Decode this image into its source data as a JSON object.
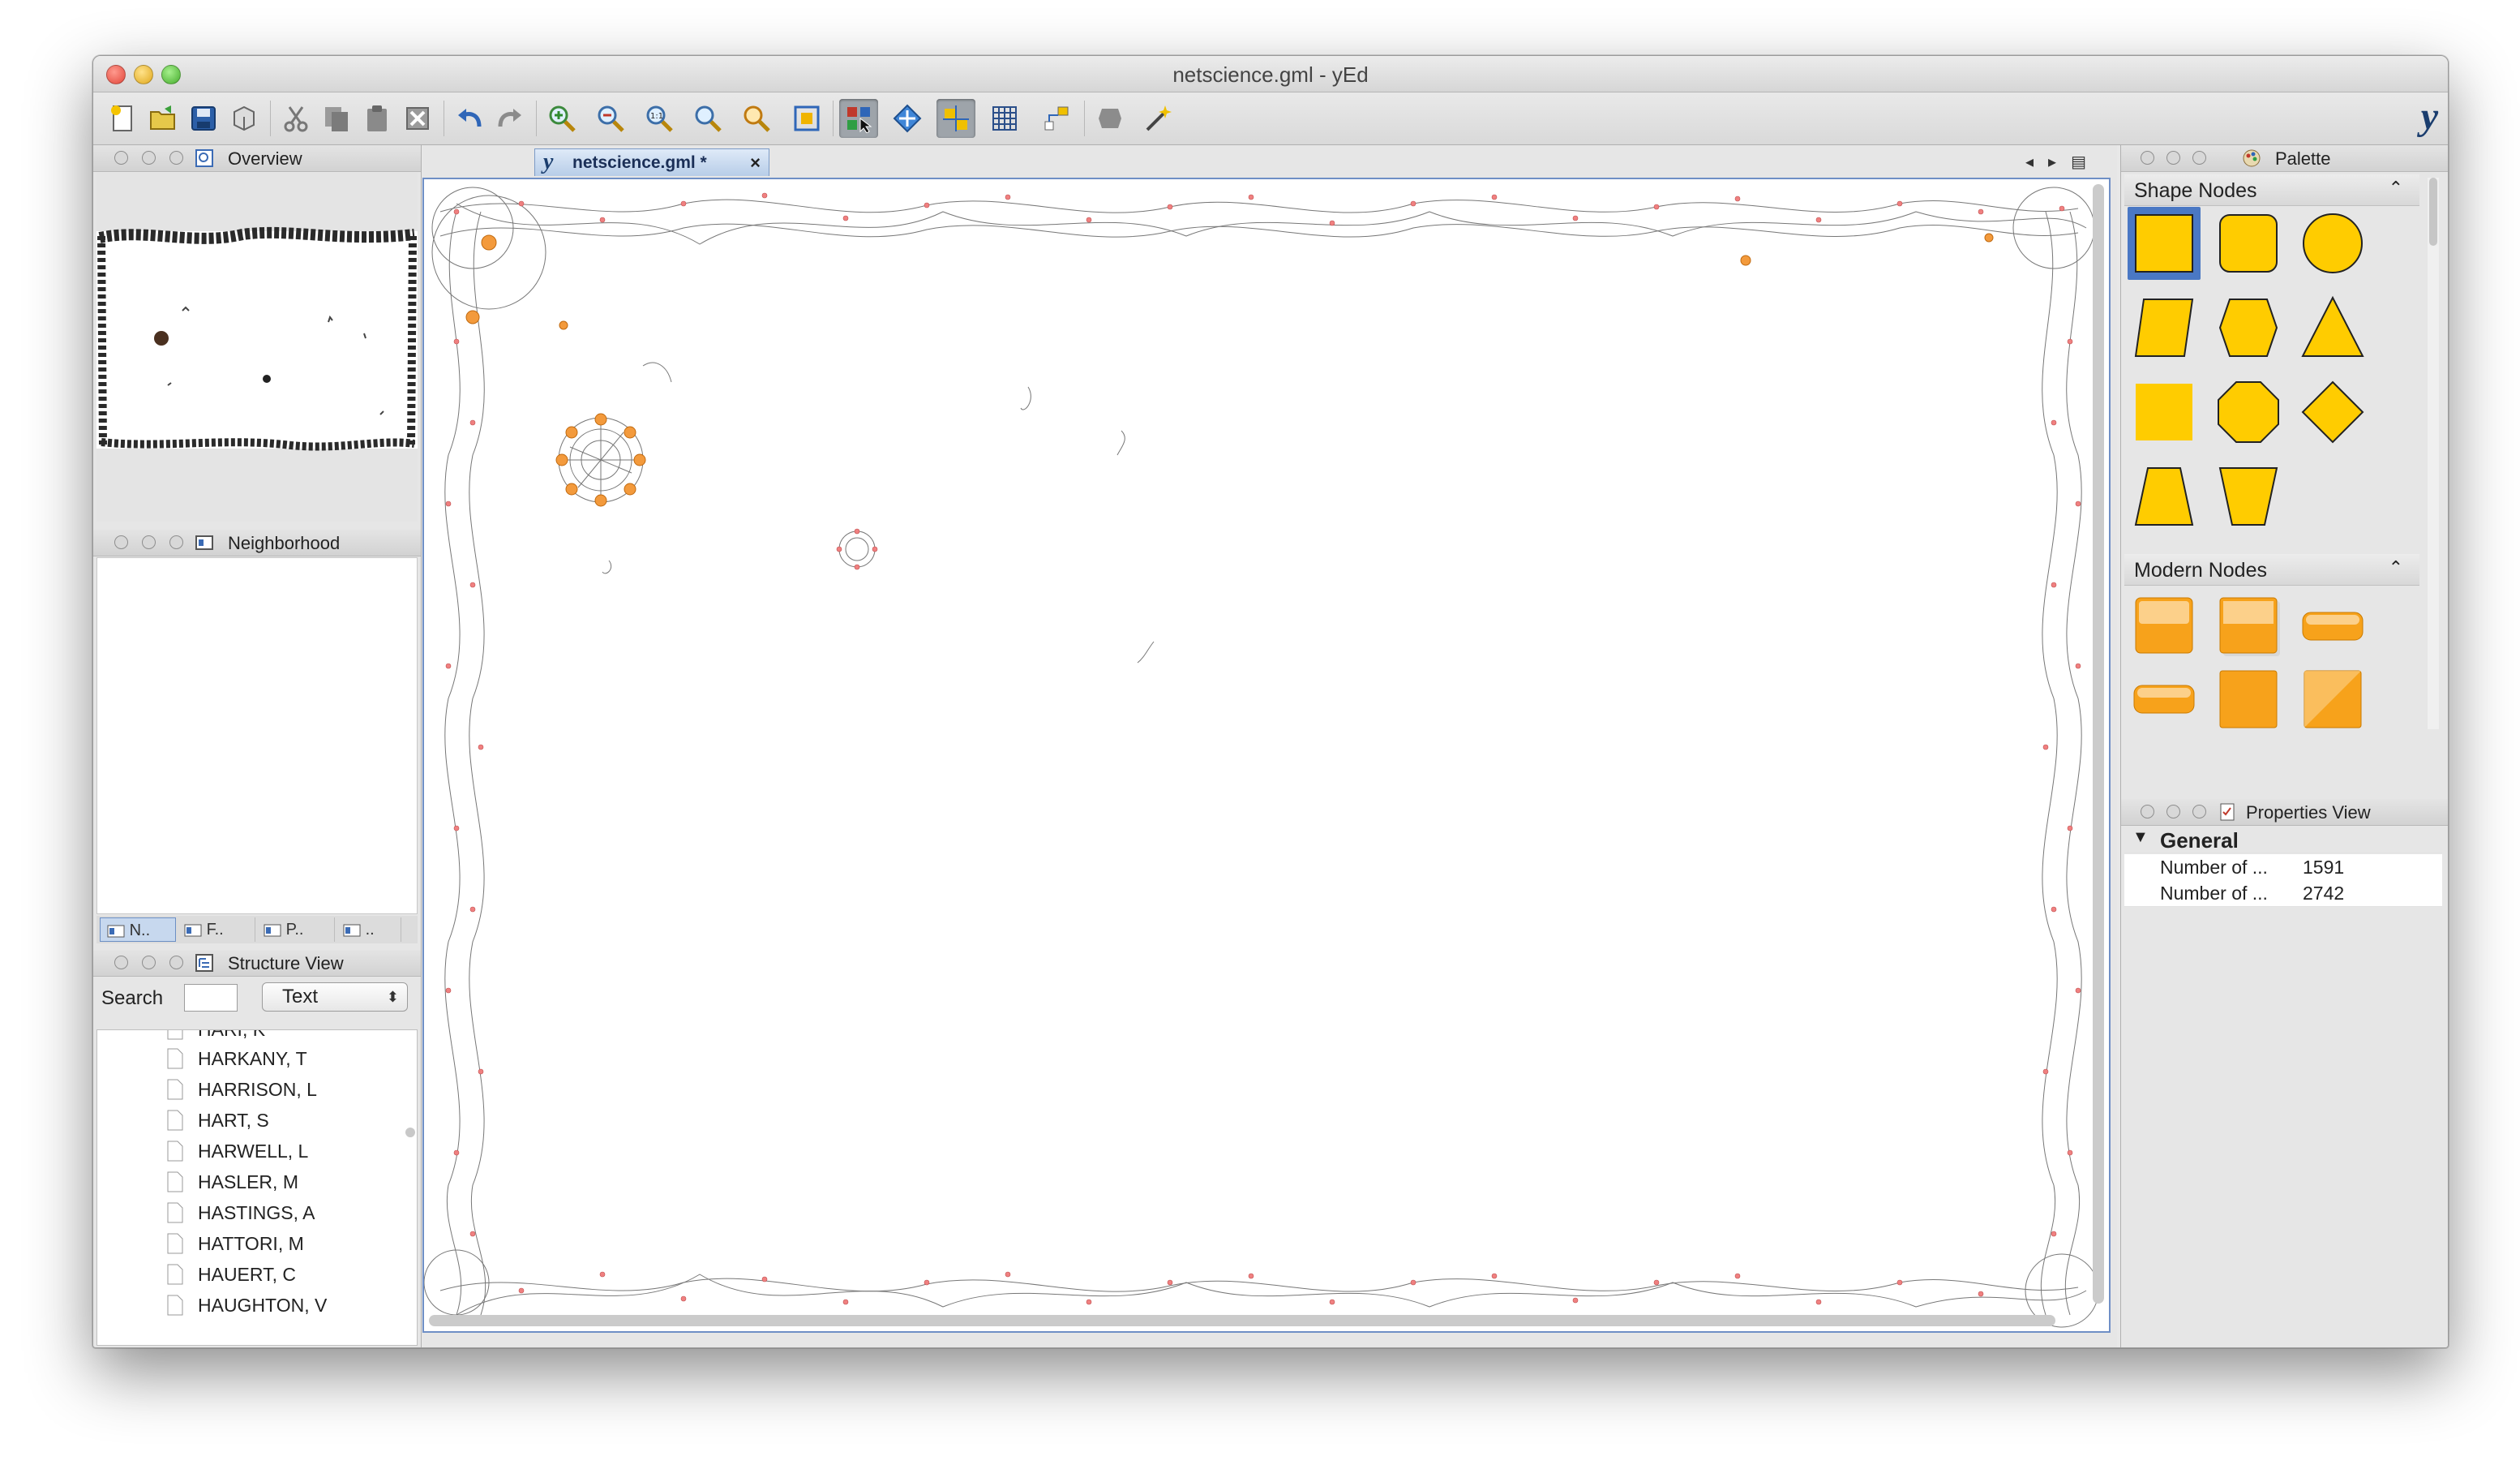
{
  "window": {
    "title": "netscience.gml - yEd"
  },
  "toolbar": {
    "buttons": [
      "new-icon",
      "open-icon",
      "save-icon",
      "export-icon",
      "cut-icon",
      "copy-icon",
      "paste-icon",
      "delete-icon",
      "undo-icon",
      "redo-icon",
      "zoom-in-icon",
      "zoom-out-icon",
      "zoom-100-icon",
      "zoom-area-icon",
      "zoom-selection-icon",
      "fit-content-icon",
      "edit-mode-icon",
      "navigate-mode-icon",
      "snap-icon",
      "grid-icon",
      "orthogonal-edges-icon",
      "layout-icon",
      "wizard-icon"
    ],
    "logo": "y"
  },
  "overview": {
    "title": "Overview"
  },
  "neighborhood": {
    "title": "Neighborhood"
  },
  "subtabs": [
    "N..",
    "F..",
    "P..",
    ".."
  ],
  "structure": {
    "title": "Structure View",
    "search_label": "Search",
    "search_value": "",
    "mode": "Text",
    "items": [
      "HARI, K",
      "HARKANY, T",
      "HARRISON, L",
      "HART, S",
      "HARWELL, L",
      "HASLER, M",
      "HASTINGS, A",
      "HATTORI, M",
      "HAUERT, C",
      "HAUGHTON, V"
    ]
  },
  "document_tab": {
    "logo": "y",
    "name": "netscience.gml *",
    "close": "×"
  },
  "palette": {
    "title": "Palette",
    "shape_section": "Shape Nodes",
    "modern_section": "Modern Nodes",
    "accent": "#ffcc00",
    "modern_color": "#f7a21b"
  },
  "properties": {
    "title": "Properties View",
    "group": "General",
    "rows": [
      {
        "key": "Number of ...",
        "value": "1591"
      },
      {
        "key": "Number of ...",
        "value": "2742"
      }
    ]
  }
}
